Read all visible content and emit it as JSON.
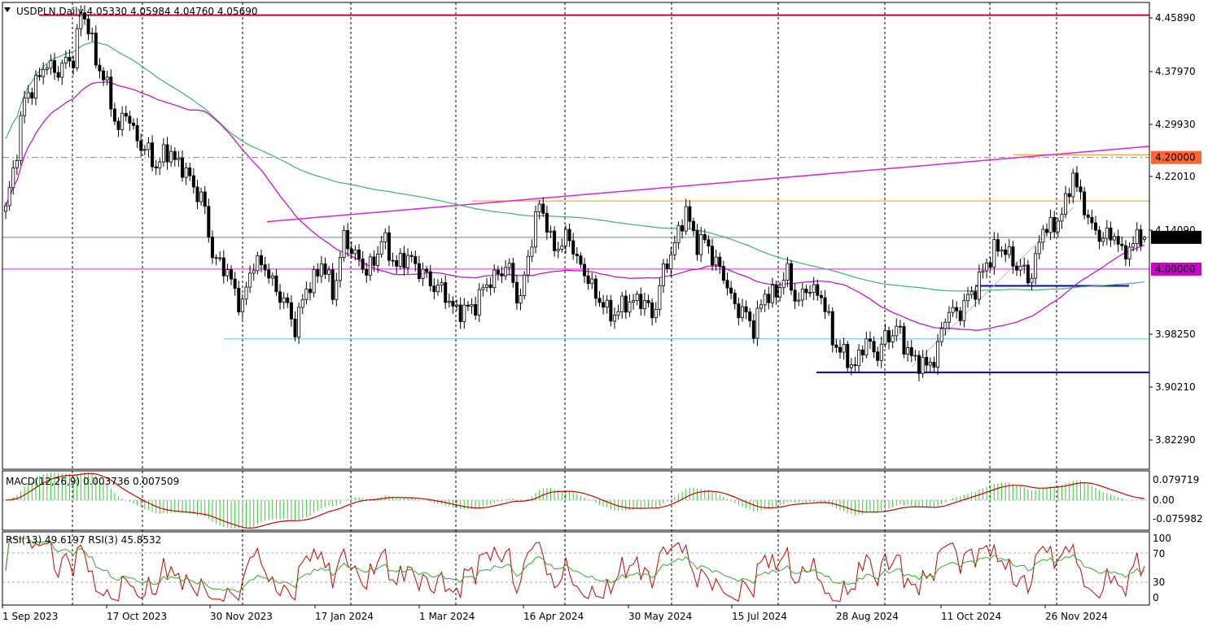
{
  "window": {
    "symbol": "USDPLN",
    "timeframe": "Daily",
    "header": "USDPLN,Daily  4.05330 4.05984 4.04760 4.05690",
    "collapse_icon": "triangle-down-icon"
  },
  "colors": {
    "bull_body": "#ffffff",
    "bear_body": "#000000",
    "ma_fast": "#cc00cc",
    "ma_slow": "#3cb371",
    "resistance": "#cc0033",
    "trend_magenta": "#dd22dd",
    "level_orange": "#ff8c00",
    "level_blue": "#0000cc",
    "level_teal": "#66cccc",
    "price_marker": "#000000",
    "level_marker": "#ff6633",
    "macd_hist": "#33cc33",
    "macd_signal": "#cc0000",
    "rsi13": "#cc0000",
    "rsi3": "#33aa33"
  },
  "price_axis": {
    "ticks": [
      "4.45890",
      "4.37970",
      "4.29930",
      "4.22010",
      "4.14090",
      "3.98250",
      "3.90210",
      "3.82290"
    ],
    "current_price_label": "4.05690",
    "level_labels": [
      "4.20000",
      "4.00000"
    ]
  },
  "time_axis": {
    "labels": [
      "1 Sep 2023",
      "17 Oct 2023",
      "30 Nov 2023",
      "17 Jan 2024",
      "1 Mar 2024",
      "16 Apr 2024",
      "30 May 2024",
      "15 Jul 2024",
      "28 Aug 2024",
      "11 Oct 2024",
      "26 Nov 2024"
    ]
  },
  "macd": {
    "label": "MACD(12,26,9) 0.003736 0.007509",
    "ticks": [
      "0.079719",
      "0.00",
      "-0.075982"
    ]
  },
  "rsi": {
    "label": "RSI(13) 49.6197  RSI(3) 45.8532",
    "ticks": [
      "100",
      "70",
      "30",
      "0"
    ]
  },
  "chart_data": {
    "type": "candlestick",
    "title": "USDPLN,Daily",
    "ylim": [
      3.79,
      4.49
    ],
    "last": {
      "open": 4.0533,
      "high": 4.05984,
      "low": 4.0476,
      "close": 4.0569
    },
    "anchors": [
      [
        0,
        4.1
      ],
      [
        5,
        4.3
      ],
      [
        10,
        4.36
      ],
      [
        15,
        4.36
      ],
      [
        18,
        4.38
      ],
      [
        20,
        4.46
      ],
      [
        22,
        4.43
      ],
      [
        24,
        4.38
      ],
      [
        28,
        4.3
      ],
      [
        30,
        4.25
      ],
      [
        32,
        4.28
      ],
      [
        36,
        4.22
      ],
      [
        40,
        4.19
      ],
      [
        44,
        4.21
      ],
      [
        48,
        4.17
      ],
      [
        52,
        4.13
      ],
      [
        55,
        4.03
      ],
      [
        60,
        3.98
      ],
      [
        63,
        3.93
      ],
      [
        66,
        4.02
      ],
      [
        70,
        3.99
      ],
      [
        74,
        3.94
      ],
      [
        77,
        3.9
      ],
      [
        80,
        3.96
      ],
      [
        84,
        4.01
      ],
      [
        87,
        3.96
      ],
      [
        90,
        4.05
      ],
      [
        93,
        4.03
      ],
      [
        96,
        3.99
      ],
      [
        100,
        4.05
      ],
      [
        104,
        4.01
      ],
      [
        108,
        4.02
      ],
      [
        112,
        3.98
      ],
      [
        115,
        3.97
      ],
      [
        118,
        3.94
      ],
      [
        122,
        3.92
      ],
      [
        126,
        3.95
      ],
      [
        130,
        3.99
      ],
      [
        134,
        4.0
      ],
      [
        137,
        3.94
      ],
      [
        140,
        4.06
      ],
      [
        142,
        4.12
      ],
      [
        145,
        4.05
      ],
      [
        148,
        4.04
      ],
      [
        150,
        4.06
      ],
      [
        153,
        4.0
      ],
      [
        156,
        3.97
      ],
      [
        160,
        3.92
      ],
      [
        164,
        3.93
      ],
      [
        168,
        3.95
      ],
      [
        172,
        3.92
      ],
      [
        175,
        3.99
      ],
      [
        178,
        4.05
      ],
      [
        181,
        4.1
      ],
      [
        184,
        4.05
      ],
      [
        187,
        4.04
      ],
      [
        190,
        4.0
      ],
      [
        193,
        3.95
      ],
      [
        196,
        3.92
      ],
      [
        199,
        3.9
      ],
      [
        202,
        3.95
      ],
      [
        205,
        3.96
      ],
      [
        208,
        3.99
      ],
      [
        211,
        3.94
      ],
      [
        214,
        3.97
      ],
      [
        217,
        3.95
      ],
      [
        220,
        3.88
      ],
      [
        223,
        3.84
      ],
      [
        226,
        3.83
      ],
      [
        229,
        3.87
      ],
      [
        232,
        3.85
      ],
      [
        235,
        3.88
      ],
      [
        237,
        3.9
      ],
      [
        239,
        3.86
      ],
      [
        242,
        3.84
      ],
      [
        245,
        3.82
      ],
      [
        248,
        3.86
      ],
      [
        251,
        3.93
      ],
      [
        254,
        3.92
      ],
      [
        257,
        3.96
      ],
      [
        260,
        3.99
      ],
      [
        263,
        4.04
      ],
      [
        266,
        4.03
      ],
      [
        269,
        4.01
      ],
      [
        272,
        3.98
      ],
      [
        274,
        4.02
      ],
      [
        276,
        4.07
      ],
      [
        279,
        4.08
      ],
      [
        282,
        4.11
      ],
      [
        284,
        4.18
      ],
      [
        286,
        4.12
      ],
      [
        289,
        4.08
      ],
      [
        292,
        4.05
      ],
      [
        295,
        4.07
      ],
      [
        297,
        4.02
      ],
      [
        299,
        4.04
      ],
      [
        301,
        4.06
      ],
      [
        303,
        4.0569
      ]
    ],
    "lines": {
      "resistance_top": 4.455,
      "level_4_20": 4.2,
      "level_4_00": 4.0,
      "orange_level": 4.122,
      "teal_support": 3.875,
      "blue_support_low": 3.815,
      "blue_level_mid": 3.97,
      "current_price": 4.0569
    }
  }
}
